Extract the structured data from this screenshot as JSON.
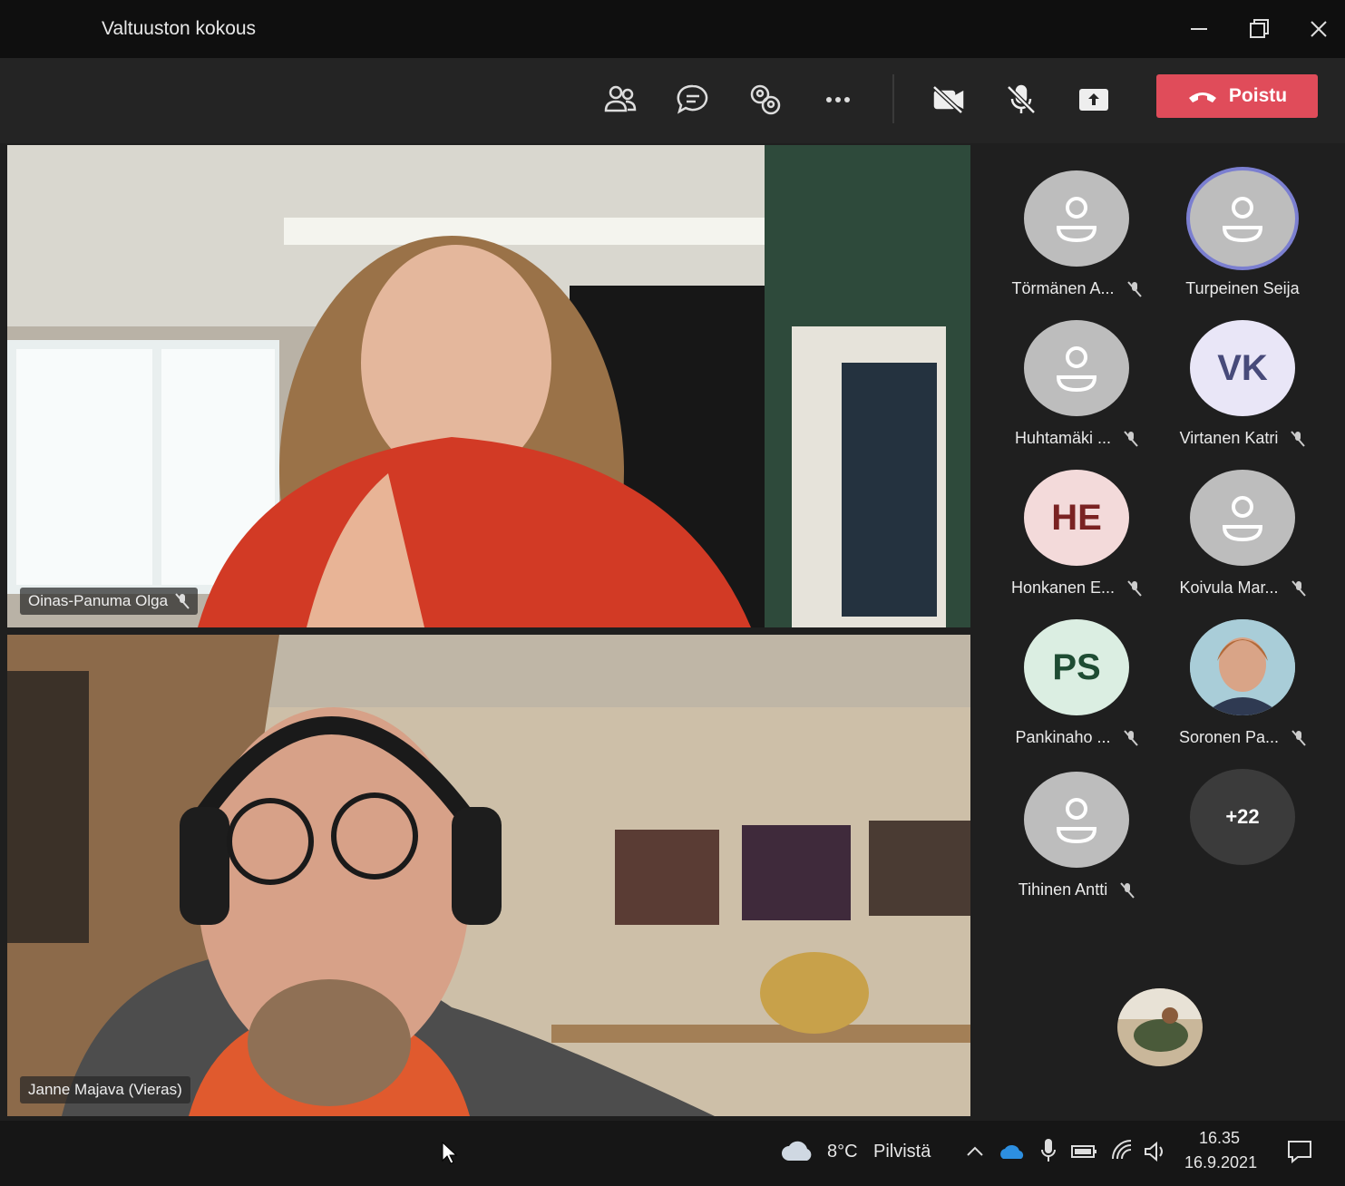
{
  "window": {
    "title": "Valtuuston kokous"
  },
  "toolbar": {
    "buttons": [
      {
        "icon": "people-icon"
      },
      {
        "icon": "chat-icon"
      },
      {
        "icon": "breakout-icon"
      },
      {
        "icon": "more-icon"
      },
      {
        "icon": "camera-off-icon"
      },
      {
        "icon": "mic-off-icon"
      },
      {
        "icon": "share-icon"
      }
    ],
    "leave_label": "Poistu",
    "leave_color": "#e04c5a"
  },
  "videos": [
    {
      "name": "Oinas-Panuma Olga",
      "muted": true
    },
    {
      "name": "Janne Majava (Vieras)",
      "muted": false
    }
  ],
  "participants": [
    {
      "name": "Törmänen A...",
      "avatar": "person-icon",
      "muted": true,
      "speaking": false
    },
    {
      "name": "Turpeinen Seija",
      "avatar": "person-icon",
      "muted": false,
      "speaking": true
    },
    {
      "name": "Huhtamäki ...",
      "avatar": "person-icon",
      "muted": true,
      "speaking": false
    },
    {
      "name": "Virtanen Katri",
      "initials": "VK",
      "avatar_bg": "#e9e6f7",
      "avatar_fg": "#474a7a",
      "muted": true
    },
    {
      "name": "Honkanen E...",
      "initials": "HE",
      "avatar_bg": "#f3dada",
      "avatar_fg": "#7a2222",
      "muted": true
    },
    {
      "name": "Koivula Mar...",
      "avatar": "person-icon",
      "muted": true
    },
    {
      "name": "Pankinaho ...",
      "initials": "PS",
      "avatar_bg": "#dbeee2",
      "avatar_fg": "#1e4c33",
      "muted": true
    },
    {
      "name": "Soronen Pa...",
      "avatar": "photo",
      "muted": true
    },
    {
      "name": "Tihinen Antti",
      "avatar": "person-icon",
      "muted": true
    },
    {
      "more": "+22"
    }
  ],
  "taskbar": {
    "weather_temp": "8°C",
    "weather_text": "Pilvistä",
    "time": "16.35",
    "date": "16.9.2021"
  }
}
